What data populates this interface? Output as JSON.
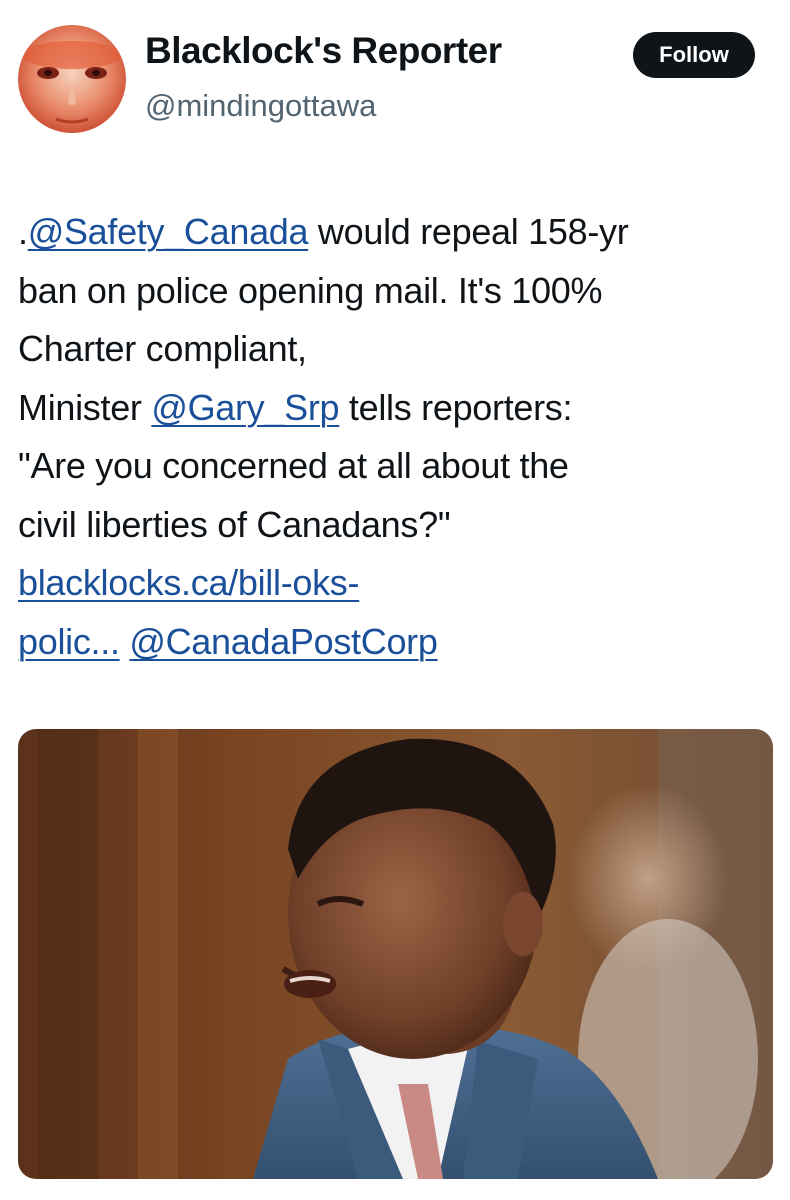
{
  "author": {
    "display_name": "Blacklock's Reporter",
    "handle": "@mindingottawa"
  },
  "follow_button": {
    "label": "Follow"
  },
  "tweet": {
    "lines": [
      [
        {
          "text": ".",
          "type": "text"
        },
        {
          "text": "@Safety_Canada",
          "type": "mention"
        },
        {
          "text": " would repeal 158-yr",
          "type": "text"
        }
      ],
      [
        {
          "text": "ban on police opening mail. It's 100%",
          "type": "text"
        }
      ],
      [
        {
          "text": "Charter compliant,",
          "type": "text"
        }
      ],
      [
        {
          "text": "Minister ",
          "type": "text"
        },
        {
          "text": "@Gary_Srp",
          "type": "mention"
        },
        {
          "text": " tells reporters:",
          "type": "text"
        }
      ],
      [
        {
          "text": "\"Are you concerned at all about the",
          "type": "text"
        }
      ],
      [
        {
          "text": "civil liberties of Canadans?\"",
          "type": "text"
        }
      ],
      [
        {
          "text": "blacklocks.ca/bill-oks-",
          "type": "link"
        }
      ],
      [
        {
          "text": "polic...",
          "type": "link"
        },
        {
          "text": " ",
          "type": "text"
        },
        {
          "text": "@CanadaPostCorp",
          "type": "mention"
        }
      ]
    ]
  },
  "colors": {
    "link": "#1a4f99",
    "text": "#0f1419",
    "secondary": "#536471",
    "button_bg": "#0f1419"
  },
  "icons": {
    "avatar": "profile-avatar-face",
    "media": "photo-man-in-suit-speaking"
  }
}
